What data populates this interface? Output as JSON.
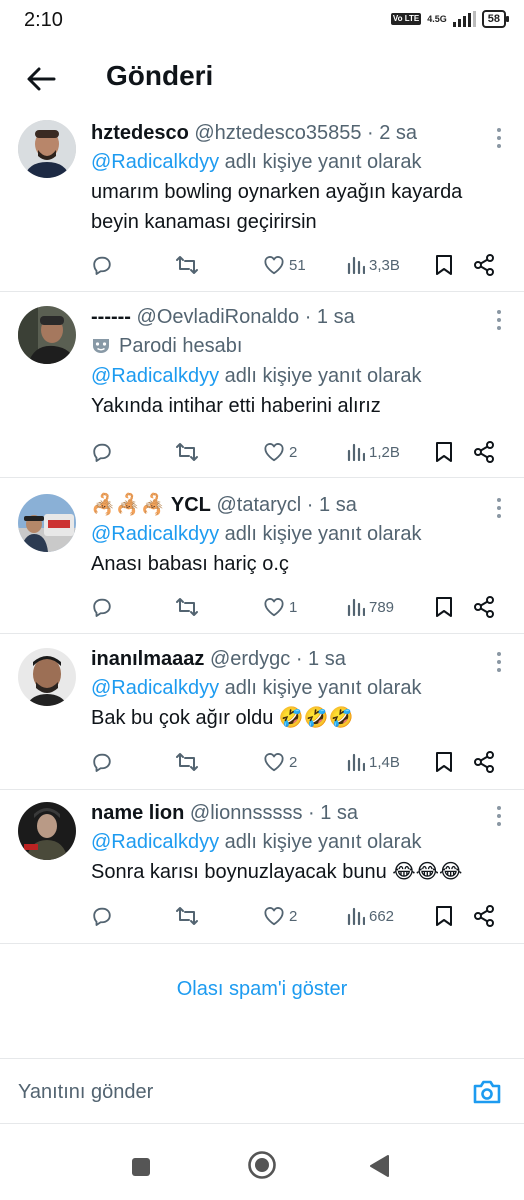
{
  "status": {
    "time": "2:10",
    "network": "4.5G",
    "volte": "Vo LTE",
    "battery": "58"
  },
  "header": {
    "title": "Gönderi"
  },
  "posts": [
    {
      "name": "hztedesco",
      "handle": "@hztedesco35855 · 2 sa",
      "reply_prefix": "@Radicalkdyy",
      "reply_suffix": " adlı kişiye yanıt olarak",
      "text": "umarım bowling oynarken ayağın kayarda beyin kanaması geçirirsin",
      "likes": "51",
      "views": "3,3B"
    },
    {
      "name": "------",
      "handle": "@OevladiRonaldo · 1 sa",
      "parody": "Parodi hesabı",
      "reply_prefix": "@Radicalkdyy",
      "reply_suffix": " adlı kişiye yanıt olarak",
      "text": "Yakında intihar etti haberini alırız",
      "likes": "2",
      "views": "1,2B"
    },
    {
      "name": "🦂🦂🦂 YCL",
      "handle": "@tatarycl · 1 sa",
      "reply_prefix": "@Radicalkdyy",
      "reply_suffix": " adlı kişiye yanıt olarak",
      "text": "Anası babası hariç o.ç",
      "likes": "1",
      "views": "789"
    },
    {
      "name": "inanılmaaaz",
      "handle": "@erdygc · 1 sa",
      "reply_prefix": "@Radicalkdyy",
      "reply_suffix": " adlı kişiye yanıt olarak",
      "text": "Bak bu çok ağır oldu 🤣🤣🤣",
      "likes": "2",
      "views": "1,4B"
    },
    {
      "name": "name lion",
      "handle": "@lionnsssss · 1 sa",
      "reply_prefix": "@Radicalkdyy",
      "reply_suffix": " adlı kişiye yanıt olarak",
      "text": "Sonra karısı boynuzlayacak bunu 😂😂😂",
      "likes": "2",
      "views": "662"
    }
  ],
  "spam_link": "Olası spam'i göster",
  "composer": {
    "placeholder": "Yanıtını gönder"
  },
  "colors": {
    "accent": "#1d9bf0",
    "secondary_text": "#536471",
    "divider": "#e6e8ea"
  }
}
